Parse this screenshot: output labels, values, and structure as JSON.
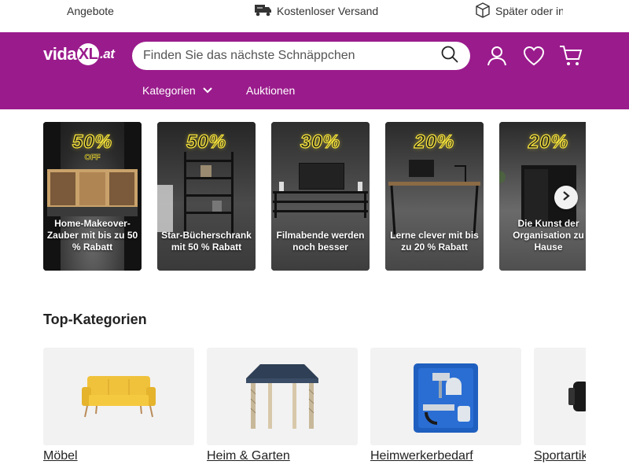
{
  "topbar": {
    "items": [
      {
        "label": "Angebote"
      },
      {
        "label": "Kostenloser Versand"
      },
      {
        "label": "Später oder in"
      }
    ]
  },
  "header": {
    "logo_brand": "vida",
    "logo_mark": "XL",
    "logo_tld": ".at",
    "search_placeholder": "Finden Sie das nächste Schnäppchen",
    "nav": {
      "categories_label": "Kategorien",
      "auctions_label": "Auktionen"
    }
  },
  "banners": [
    {
      "percent": "50%",
      "sub": "OFF",
      "caption": "Home-Makeover-Zauber mit bis zu 50 % Rabatt"
    },
    {
      "percent": "50%",
      "sub": "",
      "caption": "Star-Bücherschrank mit 50 % Rabatt"
    },
    {
      "percent": "30%",
      "sub": "",
      "caption": "Filmabende werden noch besser"
    },
    {
      "percent": "20%",
      "sub": "",
      "caption": "Lerne clever mit bis zu 20 % Rabatt"
    },
    {
      "percent": "20%",
      "sub": "",
      "caption": "Die Kunst der Organisation zu Hause"
    }
  ],
  "top_categories": {
    "title": "Top-Kategorien",
    "items": [
      {
        "label": "Möbel"
      },
      {
        "label": "Heim & Garten"
      },
      {
        "label": "Heimwerkerbedarf"
      },
      {
        "label": "Sportartikel"
      }
    ]
  },
  "colors": {
    "brand": "#9a1b8c",
    "neon_yellow": "#f6e33a",
    "tile_bg": "#f2f2f2"
  }
}
